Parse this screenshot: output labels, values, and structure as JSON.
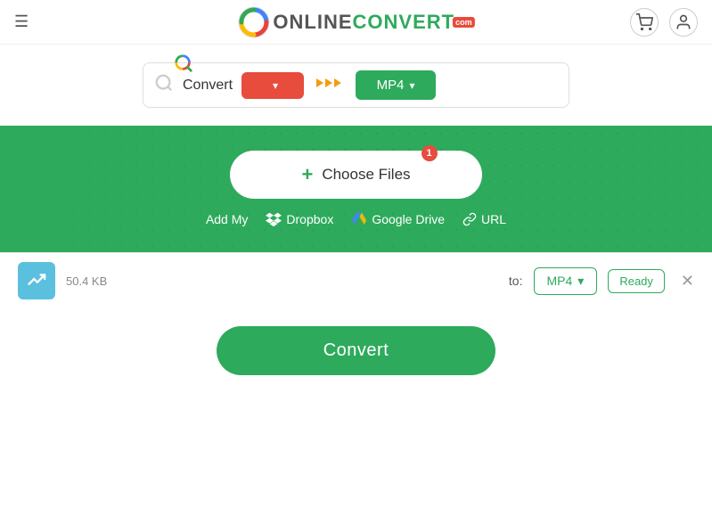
{
  "header": {
    "hamburger_label": "☰",
    "logo_online": "ONLINE",
    "logo_convert": "CONVERT",
    "logo_com": "com",
    "cart_icon": "🛒",
    "user_icon": "👤"
  },
  "search_bar": {
    "search_icon": "🔍",
    "convert_label": "Convert",
    "format_from_placeholder": "",
    "arrow_icon": "❯❯❯",
    "format_to_label": "MP4",
    "chevron": "▾"
  },
  "upload": {
    "choose_files_label": "Choose Files",
    "plus_icon": "+",
    "badge": "1",
    "add_my_label": "Add My",
    "dropbox_label": "Dropbox",
    "gdrive_label": "Google Drive",
    "url_label": "URL"
  },
  "file_row": {
    "file_icon": "↗",
    "file_size": "50.4 KB",
    "to_label": "to:",
    "format_label": "MP4",
    "chevron": "▾",
    "ready_label": "Ready",
    "remove_icon": "✕"
  },
  "convert_button": {
    "label": "Convert"
  }
}
